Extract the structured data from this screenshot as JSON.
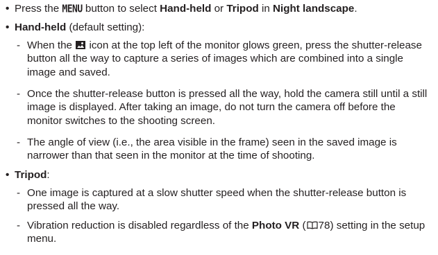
{
  "bullet_symbol": "•",
  "dash_symbol": "-",
  "intro": {
    "pre": "Press the ",
    "menu_key": "MENU",
    "mid1": " button to select ",
    "handheld": "Hand-held",
    "or": " or ",
    "tripod": "Tripod",
    "in": " in ",
    "night_landscape": "Night landscape",
    "end": "."
  },
  "handheld_section": {
    "heading": "Hand-held",
    "heading_suffix": " (default setting):",
    "items": [
      {
        "pre": "When the ",
        "icon": "night-landscape-icon",
        "post": " icon at the top left of the monitor glows green, press the shutter-release button all the way to capture a series of images which are combined into a single image and saved."
      },
      {
        "text": "Once the shutter-release button is pressed all the way, hold the camera still until a still image is displayed. After taking an image, do not turn the camera off before the monitor switches to the shooting screen."
      },
      {
        "text": "The angle of view (i.e., the area visible in the frame) seen in the saved image is narrower than that seen in the monitor at the time of shooting."
      }
    ]
  },
  "tripod_section": {
    "heading": "Tripod",
    "heading_suffix": ":",
    "items": [
      {
        "text": "One image is captured at a slow shutter speed when the shutter-release button is pressed all the way."
      },
      {
        "pre": "Vibration reduction is disabled regardless of the ",
        "bold": "Photo VR",
        "ref_open": " (",
        "ref_icon": "book-reference-icon",
        "ref_page": "78",
        "post": ") setting in the setup menu."
      }
    ]
  }
}
